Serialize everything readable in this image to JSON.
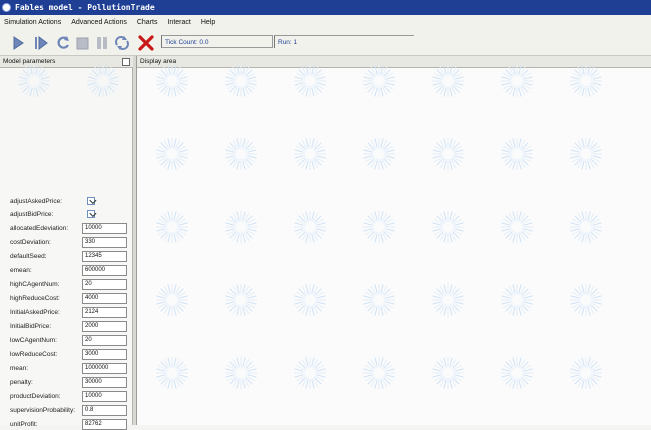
{
  "window": {
    "title": "Fables model - PollutionTrade"
  },
  "menus": [
    "Simulation Actions",
    "Advanced Actions",
    "Charts",
    "Interact",
    "Help"
  ],
  "toolbar": {
    "tick_label": "Tick Count: 0.0",
    "run_label": "Run: 1",
    "icons": [
      "play-icon",
      "step-icon",
      "reset-icon",
      "stop-icon",
      "pause-icon",
      "setup-icon",
      "exit-icon"
    ]
  },
  "left_panel": {
    "title": "Model parameters",
    "params": [
      {
        "label": "adjustAskedPrice:",
        "type": "checkbox",
        "checked": true
      },
      {
        "label": "adjustBidPrice:",
        "type": "checkbox",
        "checked": true
      },
      {
        "label": "allocatedEdeviation:",
        "type": "text",
        "value": "10000"
      },
      {
        "label": "costDeviation:",
        "type": "text",
        "value": "330"
      },
      {
        "label": "defaultSeed:",
        "type": "text",
        "value": "12345"
      },
      {
        "label": "emean:",
        "type": "text",
        "value": "600000"
      },
      {
        "label": "highCAgentNum:",
        "type": "text",
        "value": "20"
      },
      {
        "label": "highReduceCost:",
        "type": "text",
        "value": "4000"
      },
      {
        "label": "InitialAskedPrice:",
        "type": "text",
        "value": "2124"
      },
      {
        "label": "InitialBidPrice:",
        "type": "text",
        "value": "2000"
      },
      {
        "label": "lowCAgentNum:",
        "type": "text",
        "value": "20"
      },
      {
        "label": "lowReduceCost:",
        "type": "text",
        "value": "3000"
      },
      {
        "label": "mean:",
        "type": "text",
        "value": "1000000"
      },
      {
        "label": "penalty:",
        "type": "text",
        "value": "30000"
      },
      {
        "label": "productDeviation:",
        "type": "text",
        "value": "10000"
      },
      {
        "label": "supervisionProbability:",
        "type": "text",
        "value": "0.8"
      },
      {
        "label": "unitProfit:",
        "type": "text",
        "value": "82762"
      }
    ]
  },
  "right_panel": {
    "title": "Display area"
  },
  "colors": {
    "titlebar": "#1f3f95",
    "accent": "#2f62b5",
    "close": "#c81818"
  }
}
